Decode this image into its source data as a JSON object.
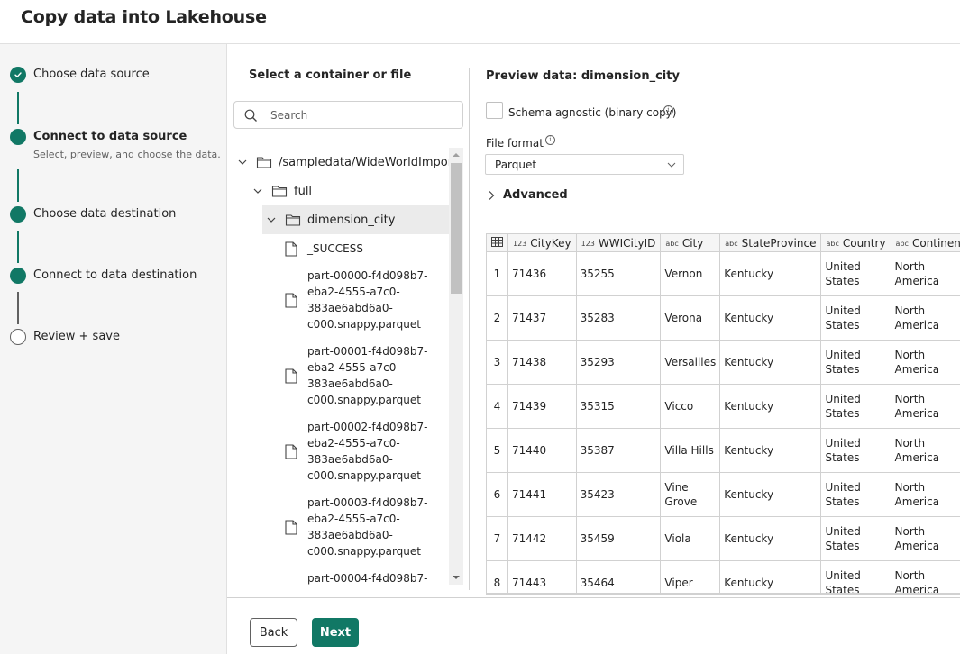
{
  "header": {
    "title": "Copy data into Lakehouse"
  },
  "colors": {
    "accent": "#117865",
    "sidebar_bg": "#f5f5f5",
    "selected_row": "#ebebeb",
    "border": "#d1d1d1"
  },
  "steps": [
    {
      "label": "Choose data source",
      "state": "completed",
      "icon": "check-icon"
    },
    {
      "label": "Connect to data source",
      "sublabel": "Select, preview, and choose the data.",
      "state": "current"
    },
    {
      "label": "Choose data destination",
      "state": "filled"
    },
    {
      "label": "Connect to data destination",
      "state": "filled"
    },
    {
      "label": "Review + save",
      "state": "pending"
    }
  ],
  "browser": {
    "heading": "Select a container or file",
    "search_placeholder": "Search",
    "tree": [
      {
        "name": "/sampledata/WideWorldImporte",
        "type": "folder",
        "expanded": true,
        "level": 0
      },
      {
        "name": "full",
        "type": "folder",
        "expanded": true,
        "level": 1
      },
      {
        "name": "dimension_city",
        "type": "folder",
        "expanded": true,
        "level": 2,
        "selected": true
      },
      {
        "name": "_SUCCESS",
        "type": "file",
        "level": 3
      },
      {
        "name_lines": [
          "part-00000-f4d098b7-",
          "eba2-4555-a7c0-",
          "383ae6abd6a0-",
          "c000.snappy.parquet"
        ],
        "type": "file",
        "level": 3
      },
      {
        "name_lines": [
          "part-00001-f4d098b7-",
          "eba2-4555-a7c0-",
          "383ae6abd6a0-",
          "c000.snappy.parquet"
        ],
        "type": "file",
        "level": 3
      },
      {
        "name_lines": [
          "part-00002-f4d098b7-",
          "eba2-4555-a7c0-",
          "383ae6abd6a0-",
          "c000.snappy.parquet"
        ],
        "type": "file",
        "level": 3
      },
      {
        "name_lines": [
          "part-00003-f4d098b7-",
          "eba2-4555-a7c0-",
          "383ae6abd6a0-",
          "c000.snappy.parquet"
        ],
        "type": "file",
        "level": 3
      },
      {
        "name_lines": [
          "part-00004-f4d098b7-"
        ],
        "type": "file",
        "level": 3
      }
    ]
  },
  "preview": {
    "heading": "Preview data: dimension_city",
    "schema_agnostic_label": "Schema agnostic (binary copy)",
    "schema_agnostic_checked": false,
    "file_format_label": "File format",
    "file_format_value": "Parquet",
    "advanced_label": "Advanced",
    "info_glyph": "i",
    "table": {
      "columns": [
        {
          "type": "123",
          "name": "CityKey"
        },
        {
          "type": "123",
          "name": "WWICityID"
        },
        {
          "type": "abc",
          "name": "City"
        },
        {
          "type": "abc",
          "name": "StateProvince"
        },
        {
          "type": "abc",
          "name": "Country"
        },
        {
          "type": "abc",
          "name": "Continent"
        }
      ],
      "rows": [
        {
          "idx": "1",
          "cells": [
            "71436",
            "35255",
            "Vernon",
            "Kentucky",
            "United States",
            "North America"
          ]
        },
        {
          "idx": "2",
          "cells": [
            "71437",
            "35283",
            "Verona",
            "Kentucky",
            "United States",
            "North America"
          ]
        },
        {
          "idx": "3",
          "cells": [
            "71438",
            "35293",
            "Versailles",
            "Kentucky",
            "United States",
            "North America"
          ]
        },
        {
          "idx": "4",
          "cells": [
            "71439",
            "35315",
            "Vicco",
            "Kentucky",
            "United States",
            "North America"
          ]
        },
        {
          "idx": "5",
          "cells": [
            "71440",
            "35387",
            "Villa Hills",
            "Kentucky",
            "United States",
            "North America"
          ]
        },
        {
          "idx": "6",
          "cells": [
            "71441",
            "35423",
            "Vine Grove",
            "Kentucky",
            "United States",
            "North America"
          ]
        },
        {
          "idx": "7",
          "cells": [
            "71442",
            "35459",
            "Viola",
            "Kentucky",
            "United States",
            "North America"
          ]
        },
        {
          "idx": "8",
          "cells": [
            "71443",
            "35464",
            "Viper",
            "Kentucky",
            "United States",
            "North America"
          ]
        }
      ]
    }
  },
  "footer": {
    "back_label": "Back",
    "next_label": "Next"
  }
}
